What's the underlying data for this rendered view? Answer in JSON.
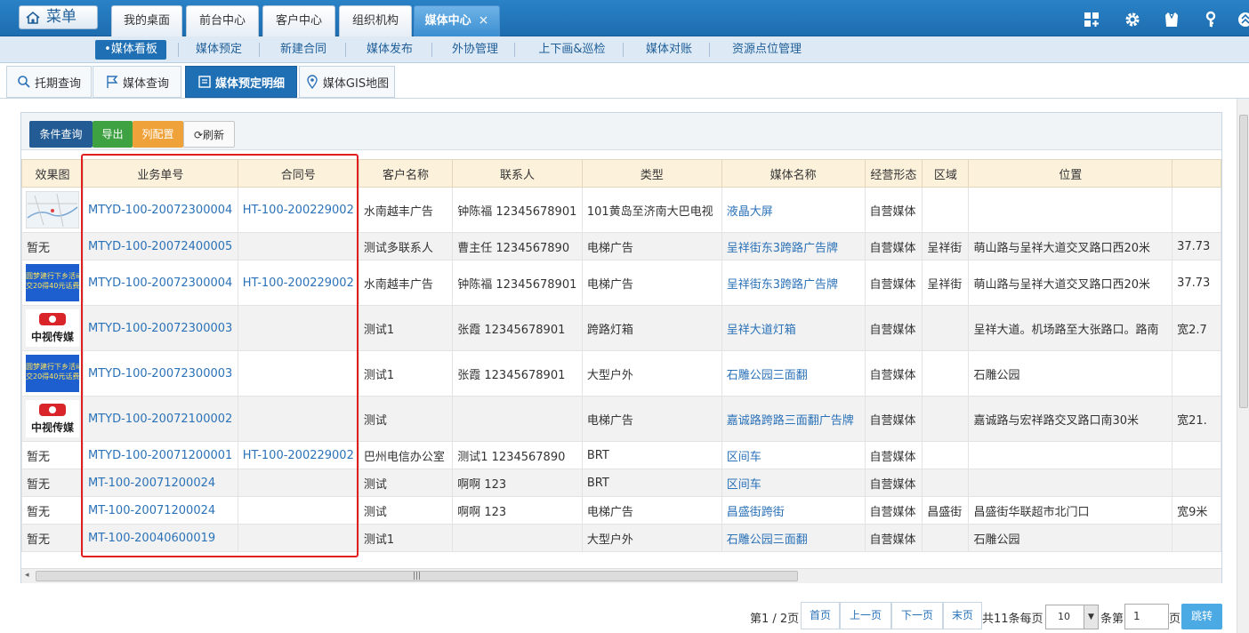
{
  "topbar": {
    "menu_label": "菜单",
    "tabs": [
      {
        "label": "我的桌面"
      },
      {
        "label": "前台中心"
      },
      {
        "label": "客户中心"
      },
      {
        "label": "组织机构"
      },
      {
        "label": "媒体中心",
        "close": "×"
      }
    ],
    "icons": [
      "grid-icon",
      "gear-icon",
      "shirt-icon",
      "key-icon",
      "collapse-icon"
    ]
  },
  "subnav": {
    "items": [
      {
        "label": "•媒体看板"
      },
      {
        "label": "媒体预定"
      },
      {
        "label": "新建合同"
      },
      {
        "label": "媒体发布"
      },
      {
        "label": "外协管理"
      },
      {
        "label": "上下画&巡检"
      },
      {
        "label": "媒体对账"
      },
      {
        "label": "资源点位管理"
      }
    ]
  },
  "pagetabs": [
    {
      "label": "托期查询",
      "icon": "search-icon"
    },
    {
      "label": "媒体查询",
      "icon": "flag-icon"
    },
    {
      "label": "媒体预定明细",
      "icon": "document-icon"
    },
    {
      "label": "媒体GIS地图",
      "icon": "map-pin-icon"
    }
  ],
  "toolbar": {
    "query": "条件查询",
    "export": "导出",
    "columns": "列配置",
    "refresh": "刷新"
  },
  "table": {
    "headers": [
      "效果图",
      "业务单号",
      "合同号",
      "客户名称",
      "联系人",
      "类型",
      "媒体名称",
      "经营形态",
      "区域",
      "位置",
      ""
    ],
    "rows": [
      {
        "thumb": "map",
        "cells": [
          "MTYD-100-20072300004",
          "HT-100-200229002",
          "水南越丰广告",
          "钟陈福 12345678901",
          "101黄岛至济南大巴电视",
          "液晶大屏",
          "自营媒体",
          "",
          "",
          ""
        ]
      },
      {
        "thumb": "暂无",
        "cells": [
          "MTYD-100-20072400005",
          "",
          "测试多联系人",
          "曹主任 1234567890",
          "电梯广告",
          "呈祥街东3跨路广告牌",
          "自营媒体",
          "呈祥街",
          "萌山路与呈祥大道交叉路口西20米",
          "37.73"
        ]
      },
      {
        "thumb": "banner",
        "cells": [
          "MTYD-100-20072300004",
          "HT-100-200229002",
          "水南越丰广告",
          "钟陈福 12345678901",
          "电梯广告",
          "呈祥街东3跨路广告牌",
          "自营媒体",
          "呈祥街",
          "萌山路与呈祥大道交叉路口西20米",
          "37.73"
        ]
      },
      {
        "thumb": "logo",
        "cells": [
          "MTYD-100-20072300003",
          "",
          "测试1",
          "张霞 12345678901",
          "跨路灯箱",
          "呈祥大道灯箱",
          "自营媒体",
          "",
          "呈祥大道。机场路至大张路口。路南",
          "宽2.7"
        ]
      },
      {
        "thumb": "banner",
        "cells": [
          "MTYD-100-20072300003",
          "",
          "测试1",
          "张霞 12345678901",
          "大型户外",
          "石雕公园三面翻",
          "自营媒体",
          "",
          "石雕公园",
          ""
        ]
      },
      {
        "thumb": "logo",
        "cells": [
          "MTYD-100-20072100002",
          "",
          "测试",
          "",
          "电梯广告",
          "嘉诚路跨路三面翻广告牌",
          "自营媒体",
          "",
          "嘉诚路与宏祥路交叉路口南30米",
          "宽21."
        ]
      },
      {
        "thumb": "暂无",
        "cells": [
          "MTYD-100-20071200001",
          "HT-100-200229002",
          "巴州电信办公室",
          "测试1 1234567890",
          "BRT",
          "区间车",
          "自营媒体",
          "",
          "",
          ""
        ]
      },
      {
        "thumb": "暂无",
        "cells": [
          "MT-100-20071200024",
          "",
          "测试",
          "啊啊 123",
          "BRT",
          "区间车",
          "自营媒体",
          "",
          "",
          ""
        ]
      },
      {
        "thumb": "暂无",
        "cells": [
          "MT-100-20071200024",
          "",
          "测试",
          "啊啊 123",
          "电梯广告",
          "昌盛街跨街",
          "自营媒体",
          "昌盛街",
          "昌盛街华联超市北门口",
          "宽9米"
        ]
      },
      {
        "thumb": "暂无",
        "cells": [
          "MT-100-20040600019",
          "",
          "测试1",
          "",
          "大型户外",
          "石雕公园三面翻",
          "自营媒体",
          "",
          "石雕公园",
          ""
        ]
      }
    ],
    "banner_text_1": "圆梦建行下乡活动",
    "banner_text_2": "交20得40元话费",
    "logo_text": "中视传媒"
  },
  "scrollbar": {
    "grip": "|||",
    "left_arrow": "◂"
  },
  "pager": {
    "page_info": "第1 / 2页",
    "first": "首页",
    "prev": "上一页",
    "next": "下一页",
    "last": "末页",
    "total_label": "共11条每页",
    "page_size": "10",
    "dropdown": "▼",
    "goto_label": "条第",
    "page_input": "1",
    "page_suffix": "页",
    "jump": "跳转"
  },
  "colors": {
    "accent": "#1f6fb5",
    "red_highlight": "#e02020",
    "link": "#2b72b8",
    "header_bg": "#fcf2dc"
  }
}
